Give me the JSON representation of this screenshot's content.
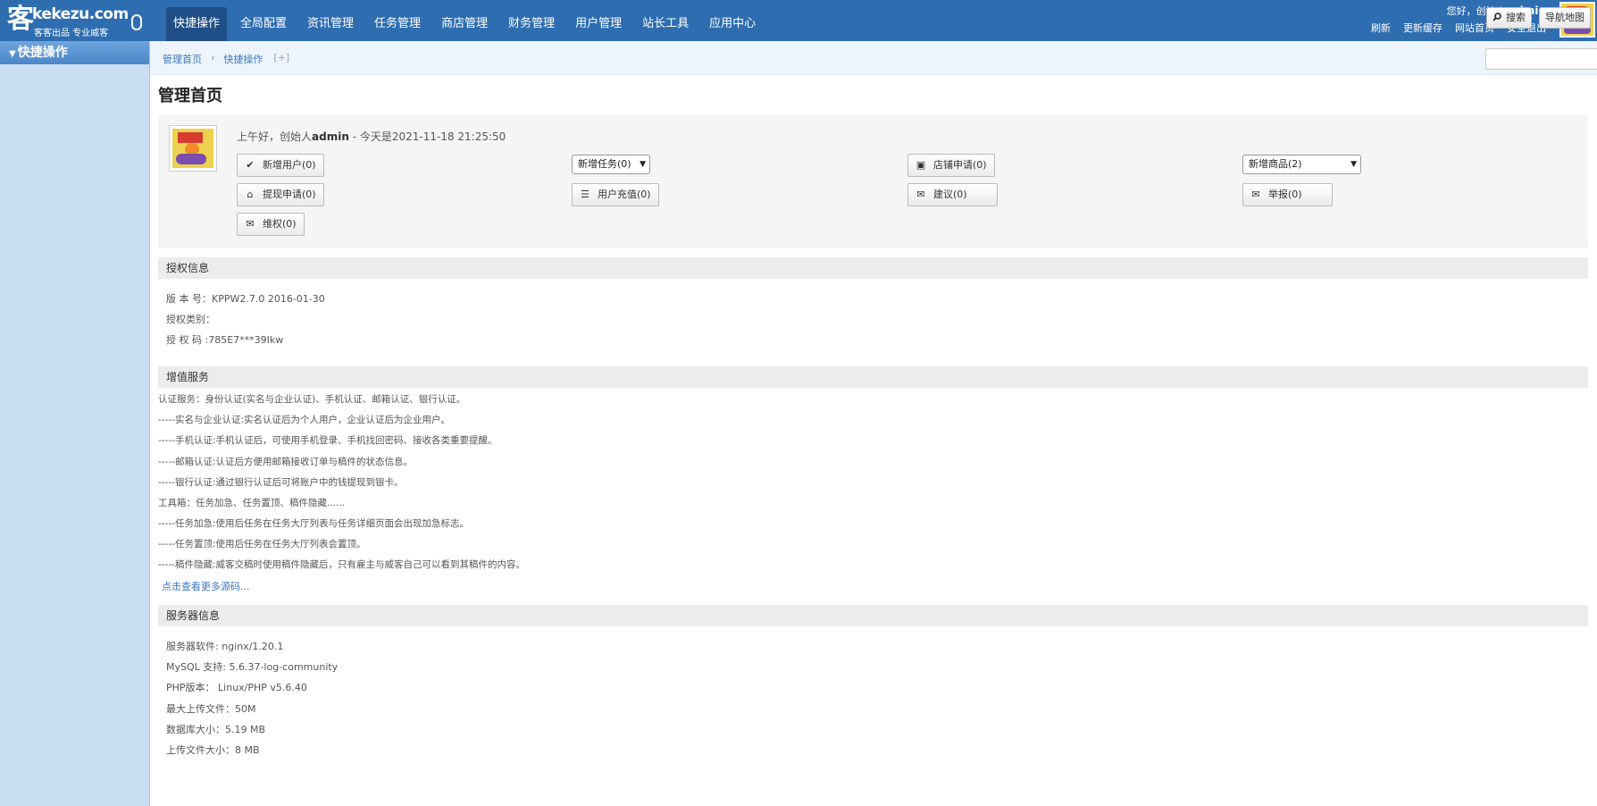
{
  "logo": {
    "glyph": "客",
    "domain": "kekezu.com",
    "slogan": "客客出品 专业威客"
  },
  "nav": {
    "items": [
      {
        "label": "快捷操作",
        "active": true
      },
      {
        "label": "全局配置"
      },
      {
        "label": "资讯管理"
      },
      {
        "label": "任务管理"
      },
      {
        "label": "商店管理"
      },
      {
        "label": "财务管理"
      },
      {
        "label": "用户管理"
      },
      {
        "label": "站长工具"
      },
      {
        "label": "应用中心"
      }
    ]
  },
  "user": {
    "greeting": "您好，创始人",
    "name": "admin",
    "links": [
      "刷新",
      "更新缓存",
      "网站首页",
      "安全退出"
    ]
  },
  "sidebar": {
    "header": "快捷操作"
  },
  "breadcrumb": {
    "items": [
      "管理首页",
      "快捷操作"
    ],
    "separator": "›",
    "add": "[+]"
  },
  "toolbar": {
    "search_label": "搜索",
    "sitemap_label": "导航地图"
  },
  "page": {
    "title": "管理首页"
  },
  "welcome": {
    "greeting": "上午好，创始人",
    "name": "admin",
    "date_text": " - 今天是2021-11-18 21:25:50"
  },
  "quick_buttons": [
    {
      "label": "新增用户(0)",
      "icon": "check-icon"
    },
    {
      "label": "提现申请(0)",
      "icon": "home-icon"
    },
    {
      "label": "维权(0)",
      "icon": "envelope-icon"
    },
    {
      "label": "用户充值(0)",
      "icon": "rss-icon"
    },
    {
      "label": "店铺申请(0)",
      "icon": "book-icon"
    },
    {
      "label": "建议(0)",
      "icon": "envelope-icon"
    },
    {
      "label": "举报(0)",
      "icon": "envelope-icon"
    }
  ],
  "quick_selects": [
    {
      "selected": "新增任务(0)"
    },
    {
      "selected": "新增商品(2)"
    }
  ],
  "license": {
    "title": "授权信息",
    "lines": [
      "版 本 号：KPPW2.7.0 2016-01-30",
      "授权类别：",
      "授 权 码 :785E7***39Ikw"
    ]
  },
  "services": {
    "title": "增值服务",
    "lines": [
      "认证服务：身份认证(实名与企业认证)、手机认证、邮箱认证、银行认证。",
      "-----实名与企业认证:实名认证后为个人用户，企业认证后为企业用户。",
      "-----手机认证:手机认证后，可使用手机登录、手机找回密码、接收各类重要提醒。",
      "-----邮箱认证:认证后方便用邮箱接收订单与稿件的状态信息。",
      "-----银行认证:通过银行认证后可将账户中的钱提现到银卡。",
      "工具箱：任务加急、任务置顶、稿件隐藏......",
      "-----任务加急:使用后任务在任务大厅列表与任务详细页面会出现加急标志。",
      "-----任务置顶:使用后任务在任务大厅列表会置顶。",
      "-----稿件隐藏:威客交稿时使用稿件隐藏后，只有雇主与威客自己可以看到其稿件的内容。"
    ],
    "more_link": "点击查看更多源码..."
  },
  "server": {
    "title": "服务器信息",
    "lines": [
      "服务器软件:  nginx/1.20.1",
      "MySQL 支持:  5.6.37-log-community",
      "PHP版本：  Linux/PHP v5.6.40",
      "最大上传文件：50M",
      "数据库大小：5.19 MB",
      "上传文件大小：8 MB"
    ]
  }
}
